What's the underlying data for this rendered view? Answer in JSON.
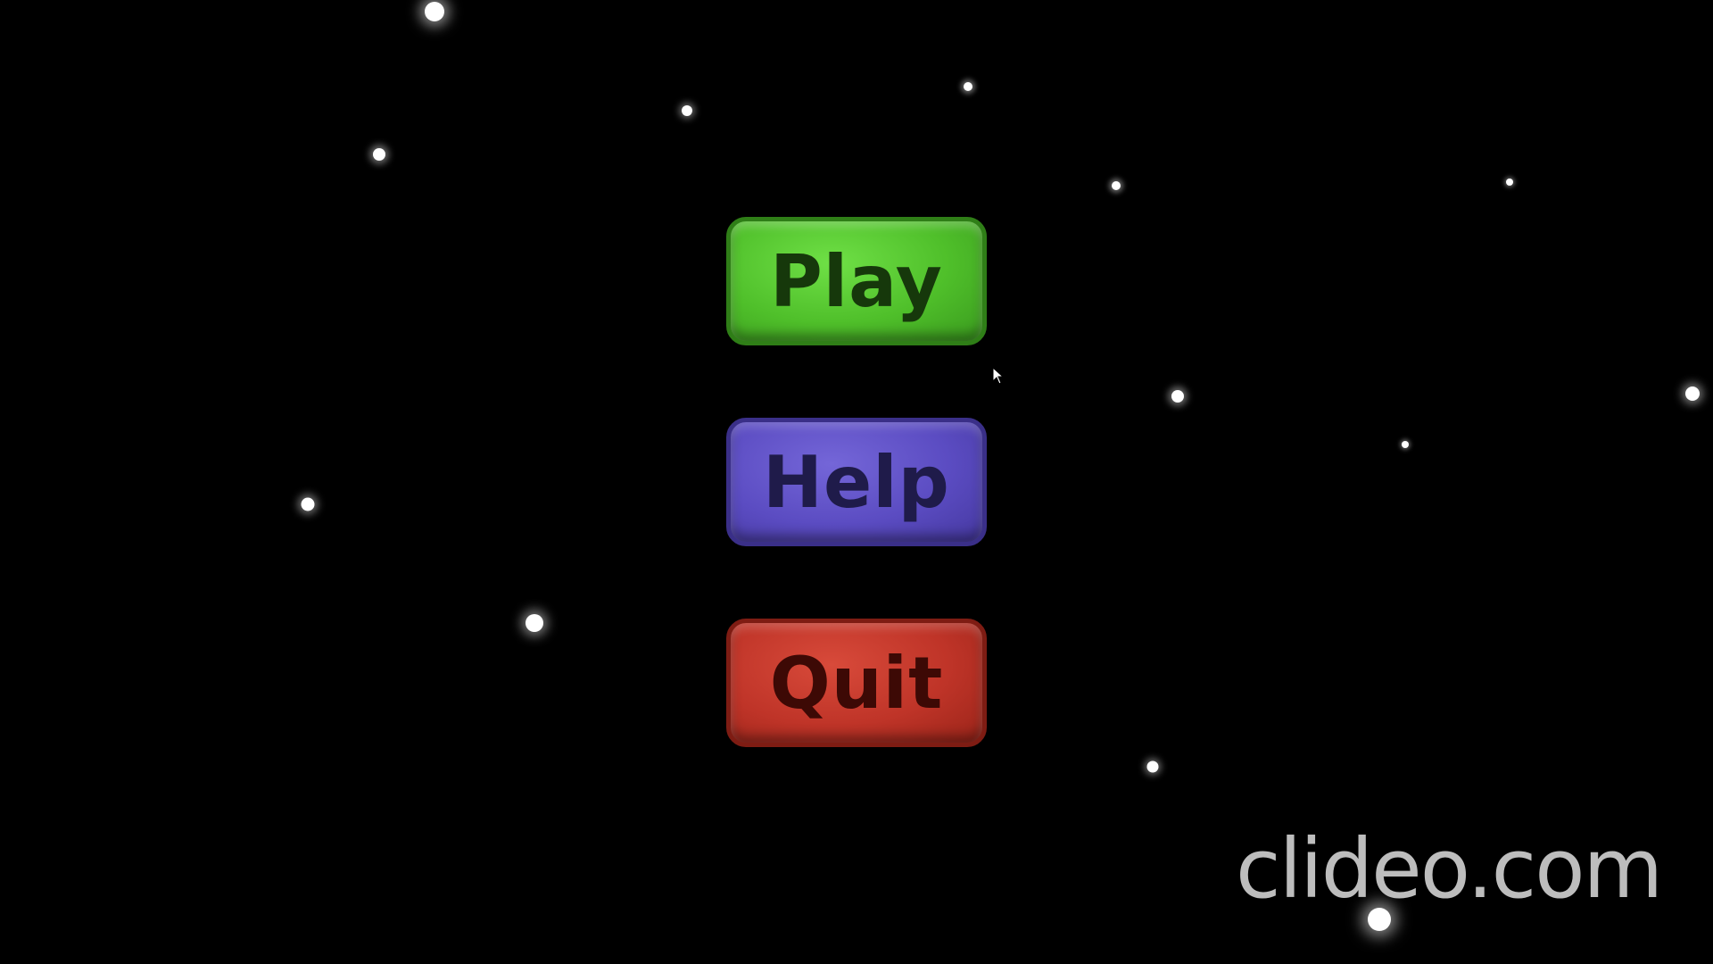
{
  "menu": {
    "play_label": "Play",
    "help_label": "Help",
    "quit_label": "Quit"
  },
  "watermark": {
    "text": "clideo.com"
  },
  "colors": {
    "background": "#000000",
    "play": "#4fbf2a",
    "help": "#5b4cc2",
    "quit": "#bf3428"
  }
}
